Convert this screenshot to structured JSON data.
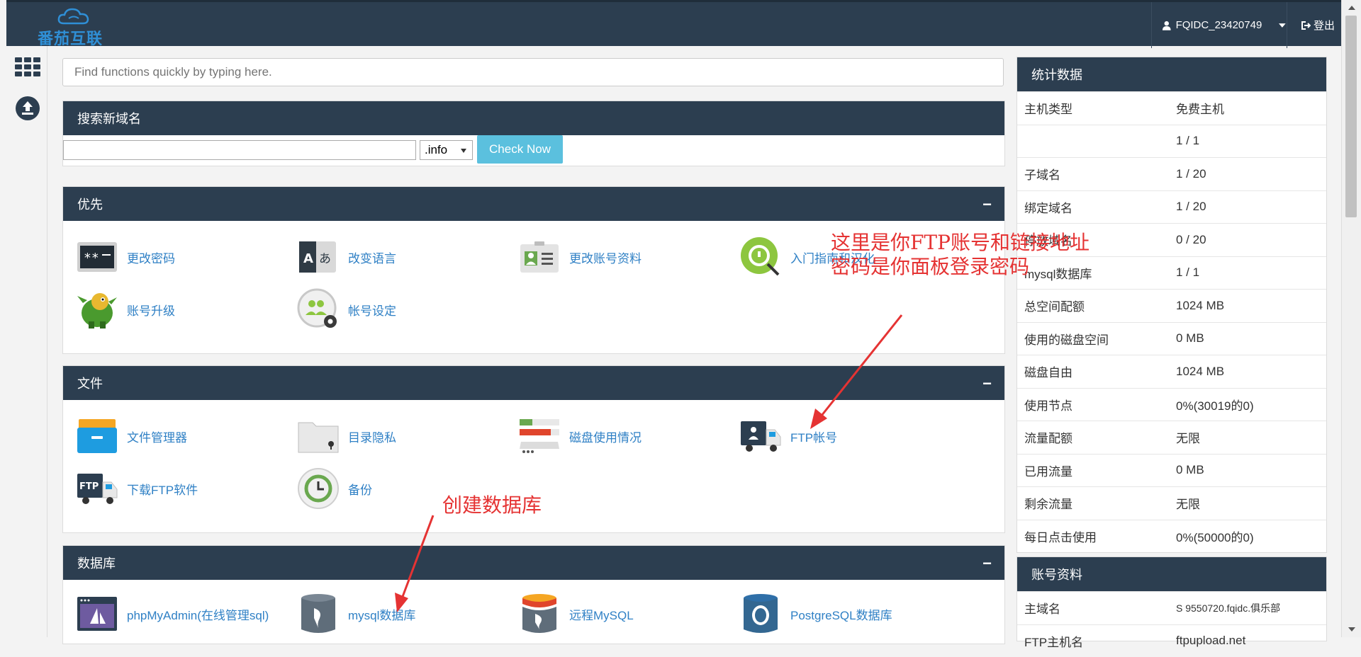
{
  "brand": {
    "logo_text": "番茄互联"
  },
  "header": {
    "username": "FQIDC_23420749",
    "logout_label": "登出"
  },
  "search": {
    "placeholder": "Find functions quickly by typing here."
  },
  "domain_search": {
    "title": "搜索新域名",
    "input_value": "",
    "tld_selected": ".info",
    "button_label": "Check Now"
  },
  "panels": {
    "priority": {
      "title": "优先",
      "collapse_symbol": "−",
      "items": [
        "更改密码",
        "改变语言",
        "更改账号资料",
        "入门指南和汉化",
        "账号升级",
        "帐号设定"
      ]
    },
    "files": {
      "title": "文件",
      "collapse_symbol": "−",
      "items": [
        "文件管理器",
        "目录隐私",
        "磁盘使用情况",
        "FTP帐号",
        "下载FTP软件",
        "备份"
      ]
    },
    "databases": {
      "title": "数据库",
      "collapse_symbol": "−",
      "items": [
        "phpMyAdmin(在线管理sql)",
        "mysql数据库",
        "远程MySQL",
        "PostgreSQL数据库"
      ]
    }
  },
  "stats": {
    "title": "统计数据",
    "rows": [
      {
        "k": "主机类型",
        "v": "免费主机"
      },
      {
        "k": "",
        "v": "1 / 1"
      },
      {
        "k": "子域名",
        "v": "1 / 20"
      },
      {
        "k": "绑定域名",
        "v": "1 / 20"
      },
      {
        "k": "停放域名",
        "v": "0 / 20"
      },
      {
        "k": "mysql数据库",
        "v": "1 / 1"
      },
      {
        "k": "总空间配额",
        "v": "1024 MB"
      },
      {
        "k": "使用的磁盘空间",
        "v": "0 MB"
      },
      {
        "k": "磁盘自由",
        "v": "1024 MB"
      },
      {
        "k": "使用节点",
        "v": "0%(30019的0)"
      },
      {
        "k": "流量配额",
        "v": "无限"
      },
      {
        "k": "已用流量",
        "v": "0 MB"
      },
      {
        "k": "剩余流量",
        "v": "无限"
      },
      {
        "k": "每日点击使用",
        "v": "0%(50000的0)"
      }
    ]
  },
  "account": {
    "title": "账号资料",
    "rows": [
      {
        "k": "主域名",
        "v": "S 9550720.fqidc.俱乐部"
      },
      {
        "k": "FTP主机名",
        "v": "ftpupload.net"
      }
    ]
  },
  "annotations": {
    "ftp_note_line1": "这里是你FTP账号和链接地址",
    "ftp_note_line2": "密码是你面板登录密码",
    "db_note": "创建数据库"
  },
  "colors": {
    "header_bg": "#2c3e50",
    "link": "#2f80c5",
    "button": "#5bc0de",
    "annotation": "#e53333"
  }
}
